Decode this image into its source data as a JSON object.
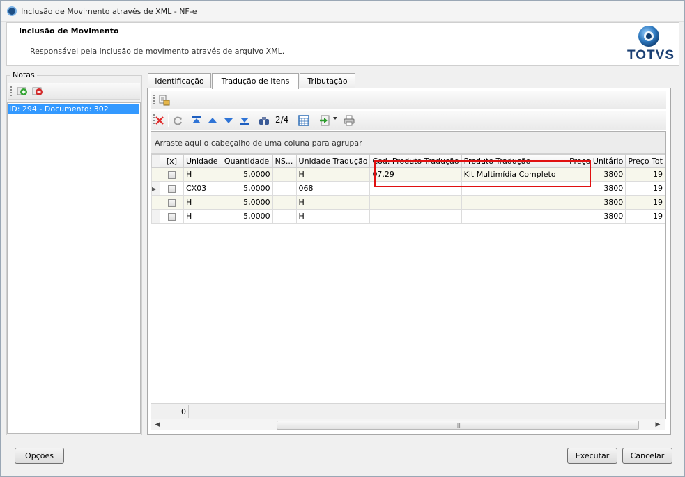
{
  "window": {
    "title": "Inclusão de Movimento através de XML - NF-e"
  },
  "header": {
    "title": "Inclusão de Movimento",
    "subtitle": "Responsável pela inclusão de movimento através de arquivo XML.",
    "logo_text": "TOTVS"
  },
  "notas": {
    "label": "Notas",
    "items": [
      {
        "label": "ID: 294 - Documento: 302",
        "selected": true
      }
    ]
  },
  "tabs": [
    {
      "label": "Identificação",
      "active": false
    },
    {
      "label": "Tradução de Itens",
      "active": true
    },
    {
      "label": "Tributação",
      "active": false
    }
  ],
  "toolbar": {
    "pager": "2/4"
  },
  "grid": {
    "group_hint": "Arraste aqui o cabeçalho de uma coluna para agrupar",
    "columns": [
      "[x]",
      "Unidade",
      "Quantidade",
      "NS...",
      "Unidade Tradução",
      "Cod. Produto Tradução",
      "Produto Tradução",
      "Preço Unitário",
      "Preço Tot"
    ],
    "rows": [
      {
        "unidade": "H",
        "quantidade": "5,0000",
        "ns": "",
        "unidade_traducao": "H",
        "cod_produto": "07.29",
        "produto": "Kit Multimídia Completo",
        "preco_unitario": "3800",
        "preco_total": "19"
      },
      {
        "unidade": "CX03",
        "quantidade": "5,0000",
        "ns": "",
        "unidade_traducao": "068",
        "cod_produto": "",
        "produto": "",
        "preco_unitario": "3800",
        "preco_total": "19"
      },
      {
        "unidade": "H",
        "quantidade": "5,0000",
        "ns": "",
        "unidade_traducao": "H",
        "cod_produto": "",
        "produto": "",
        "preco_unitario": "3800",
        "preco_total": "19"
      },
      {
        "unidade": "H",
        "quantidade": "5,0000",
        "ns": "",
        "unidade_traducao": "H",
        "cod_produto": "",
        "produto": "",
        "preco_unitario": "3800",
        "preco_total": "19"
      }
    ],
    "footer_count": "0"
  },
  "buttons": {
    "opcoes": "Opções",
    "executar": "Executar",
    "cancelar": "Cancelar"
  },
  "colors": {
    "selection": "#3399ff",
    "highlight_box": "#e01010",
    "logo": "#1a3f73"
  }
}
